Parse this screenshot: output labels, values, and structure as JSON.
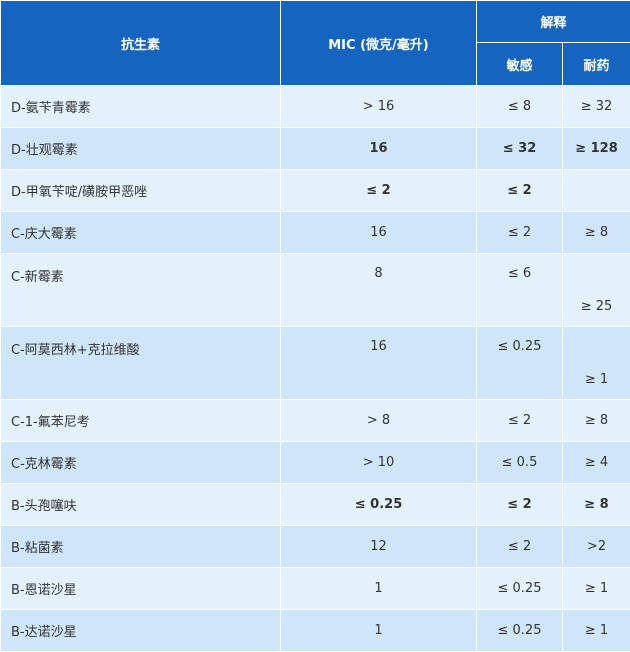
{
  "header": {
    "antibiotic": "抗生素",
    "mic": "MIC (微克/毫升)",
    "interpretation": "解释",
    "susceptible": "敏感",
    "resistant": "耐药"
  },
  "rows": [
    {
      "name": "D-氨苄青霉素",
      "mic": "> 16",
      "s": "≤ 8",
      "r": "≥ 32"
    },
    {
      "name": "D-壮观霉素",
      "mic": "16",
      "s": "≤ 32",
      "r": "≥ 128"
    },
    {
      "name": "D-甲氧苄啶/磺胺甲恶唑",
      "mic": "≤ 2",
      "s": "≤ 2",
      "r": ""
    },
    {
      "name": "C-庆大霉素",
      "mic": "16",
      "s": "≤ 2",
      "r": "≥ 8"
    },
    {
      "name": "C-新霉素",
      "mic": "8",
      "s": "≤ 6",
      "r": "≥ 25"
    },
    {
      "name": "C-阿莫西林+克拉维酸",
      "mic": "16",
      "s": "≤ 0.25",
      "r": "≥ 1"
    },
    {
      "name": "C-1-氟苯尼考",
      "mic": "> 8",
      "s": "≤ 2",
      "r": "≥ 8"
    },
    {
      "name": "C-克林霉素",
      "mic": "> 10",
      "s": "≤ 0.5",
      "r": "≥ 4"
    },
    {
      "name": "B-头孢噻呋",
      "mic": "≤ 0.25",
      "s": "≤ 2",
      "r": "≥ 8"
    },
    {
      "name": "B-粘菌素",
      "mic": "12",
      "s": "≤ 2",
      "r": ">2"
    },
    {
      "name": "B-恩诺沙星",
      "mic": "1",
      "s": "≤ 0.25",
      "r": "≥ 1"
    },
    {
      "name": "B-达诺沙星",
      "mic": "1",
      "s": "≤ 0.25",
      "r": "≥ 1"
    }
  ]
}
